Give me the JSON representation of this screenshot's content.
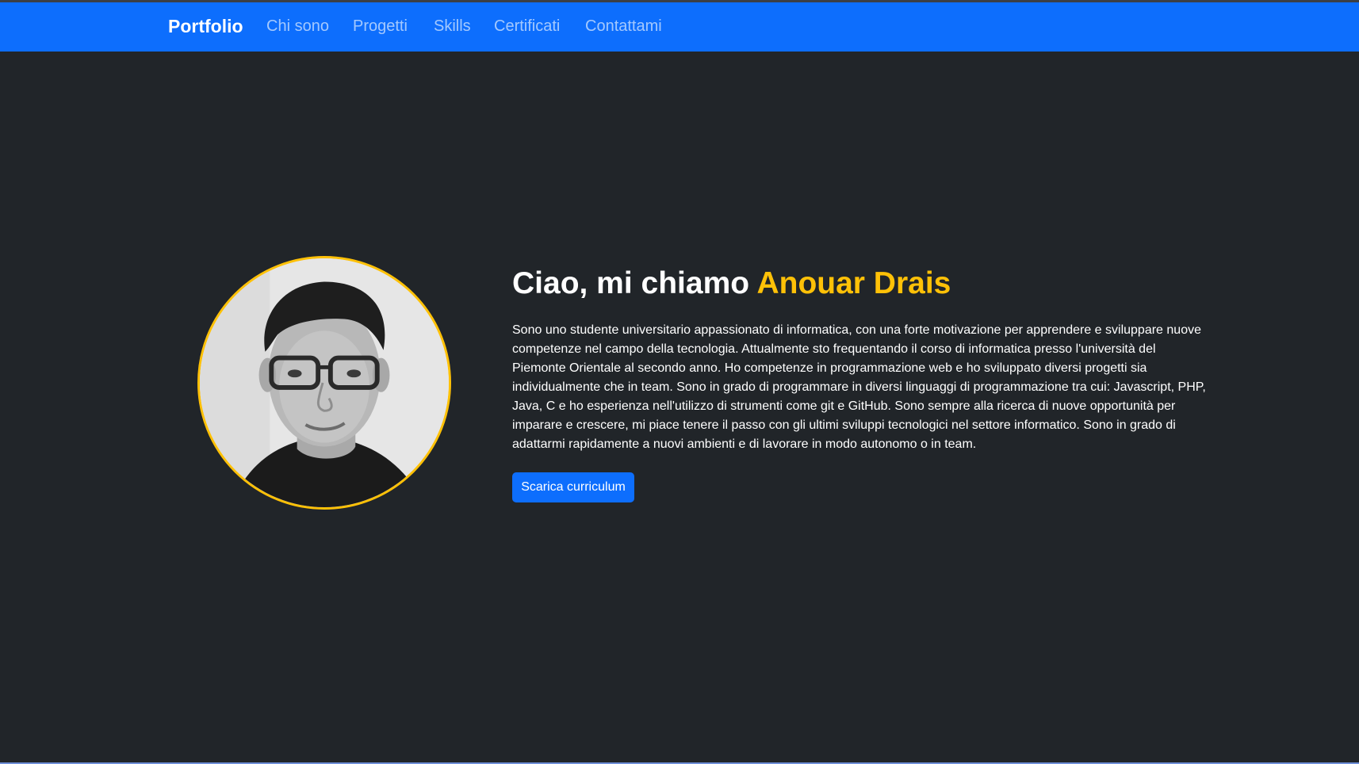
{
  "navbar": {
    "brand": "Portfolio",
    "links": [
      "Chi sono",
      "Progetti",
      "Skills",
      "Certificati",
      "Contattami"
    ],
    "background_color": "#0d6efd"
  },
  "hero": {
    "greeting": "Ciao, mi chiamo",
    "name": "Anouar Drais",
    "bio": "Sono uno studente universitario appassionato di informatica, con una forte motivazione per apprendere e sviluppare nuove competenze nel campo della tecnologia. Attualmente sto frequentando il corso di informatica presso l'università del Piemonte Orientale al secondo anno. Ho competenze in programmazione web e ho sviluppato diversi progetti sia individualmente che in team. Sono in grado di programmare in diversi linguaggi di programmazione tra cui: Javascript, PHP, Java, C e ho esperienza nell'utilizzo di strumenti come git e GitHub. Sono sempre alla ricerca di nuove opportunità per imparare e crescere, mi piace tenere il passo con gli ultimi sviluppi tecnologici nel settore informatico. Sono in grado di adattarmi rapidamente a nuovi ambienti e di lavorare in modo autonomo o in team.",
    "cv_button": "Scarica curriculum",
    "background_color": "#212529",
    "accent_color": "#ffc107"
  }
}
